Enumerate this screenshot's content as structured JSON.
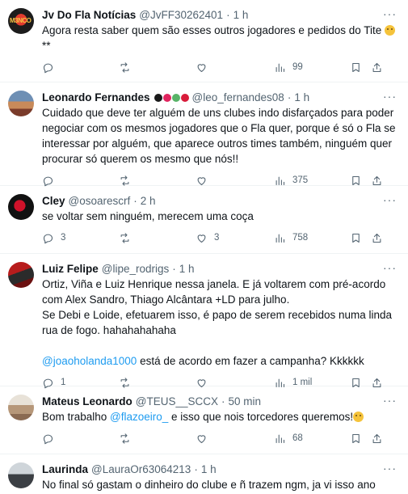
{
  "tweets": [
    {
      "name": "Jv Do Fla Notícias",
      "handle": "@JvFF30262401",
      "dot": "·",
      "time": "1 h",
      "text": "Agora resta saber quem são esses outros jogadores e pedidos do Tite",
      "text_suffix": "**",
      "replies": "",
      "retweets": "",
      "likes": "",
      "views": "99"
    },
    {
      "name": "Leonardo Fernandes",
      "handle": "@leo_fernandes08",
      "dot": "·",
      "time": "1 h",
      "text": "Cuidado que deve ter alguém de uns clubes indo disfarçados para poder negociar com os mesmos jogadores que o Fla quer, porque é só o Fla se interessar por alguém, que aparece outros times também, ninguém quer procurar só querem os mesmo que nós!!",
      "replies": "",
      "retweets": "",
      "likes": "",
      "views": "375"
    },
    {
      "name": "Cley",
      "handle": "@osoarescrf",
      "dot": "·",
      "time": "2 h",
      "text": "se voltar sem ninguém, merecem uma coça",
      "replies": "3",
      "retweets": "",
      "likes": "3",
      "views": "758"
    },
    {
      "name": "Luiz Felipe",
      "handle": "@lipe_rodrigs",
      "dot": "·",
      "time": "1 h",
      "text": "Ortiz, Viña e Luiz Henrique nessa janela. E já voltarem com pré-acordo com Alex Sandro, Thiago Alcântara +LD para julho.\nSe Debi e Loide, efetuarem isso, é papo de serem recebidos numa linda rua de fogo.  hahahahahaha",
      "mention": "@joaoholanda1000",
      "text_after_mention": " está de acordo em fazer a campanha? Kkkkkk",
      "replies": "1",
      "retweets": "",
      "likes": "",
      "views": "1 mil"
    },
    {
      "name": "Mateus Leonardo",
      "handle": "@TEUS__SCCX",
      "dot": "·",
      "time": "50 min",
      "text_before_mention": "Bom trabalho ",
      "mention": "@flazoeiro_",
      "text_after_mention": " e isso que nois torcedores queremos!",
      "replies": "",
      "retweets": "",
      "likes": "",
      "views": "68"
    },
    {
      "name": "Laurinda",
      "handle": "@LauraOr63064213",
      "dot": "·",
      "time": "1 h",
      "text": "No final só gastam o dinheiro do clube e ñ trazem ngm, ja vi isso ano"
    }
  ],
  "icons": {
    "more": "more-icon",
    "reply": "reply-icon",
    "retweet": "retweet-icon",
    "like": "heart-icon",
    "views": "views-icon",
    "bookmark": "bookmark-icon",
    "share": "share-icon"
  },
  "colors": {
    "text": "#0f1419",
    "secondary": "#536471",
    "link": "#1d9bf0",
    "divider": "#eff3f4"
  }
}
